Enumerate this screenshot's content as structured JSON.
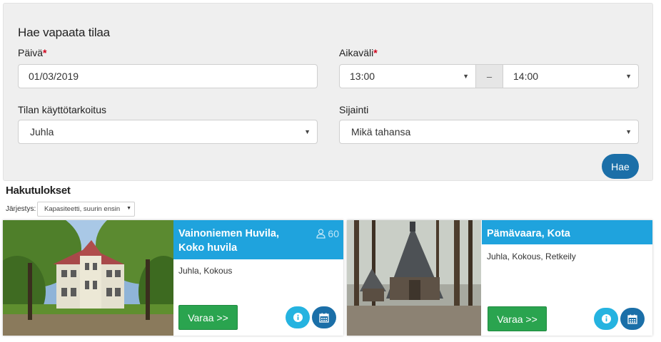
{
  "search": {
    "title": "Hae vapaata tilaa",
    "date_label": "Päivä",
    "date_value": "01/03/2019",
    "time_label": "Aikaväli",
    "time_start": "13:00",
    "time_separator": "–",
    "time_end": "14:00",
    "required_mark": "*",
    "purpose_label": "Tilan käyttötarkoitus",
    "purpose_value": "Juhla",
    "location_label": "Sijainti",
    "location_value": "Mikä tahansa",
    "search_button": "Hae"
  },
  "results": {
    "title": "Hakutulokset",
    "sort_label": "Järjestys:",
    "sort_value": "Kapasiteetti, suurin ensin",
    "cards": [
      {
        "title": "Vainoniemen Huvila, Koko huvila",
        "capacity": "60",
        "tags": "Juhla, Kokous",
        "book_label": "Varaa >>",
        "image": "villa-photo"
      },
      {
        "title": "Pämävaara, Kota",
        "capacity": "",
        "tags": "Juhla, Kokous, Retkeily",
        "book_label": "Varaa >>",
        "image": "hut-photo"
      }
    ]
  },
  "colors": {
    "primary": "#1b6fa8",
    "card_header": "#1fa3dd",
    "book_button": "#2aa44f",
    "info_button": "#25b3e0",
    "required": "#d0021b"
  }
}
